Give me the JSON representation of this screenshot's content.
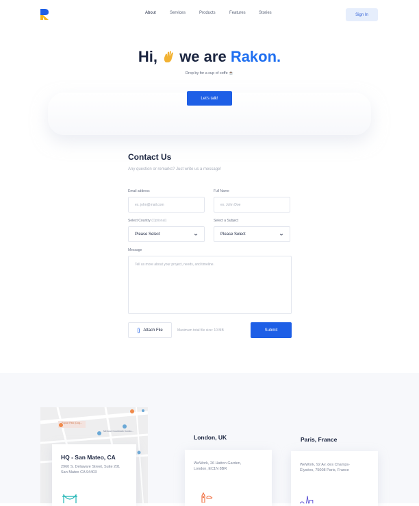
{
  "header": {
    "logo_name": "rakon-logo",
    "nav": [
      {
        "label": "About"
      },
      {
        "label": "Services"
      },
      {
        "label": "Products"
      },
      {
        "label": "Features"
      },
      {
        "label": "Stories"
      }
    ],
    "sign_in": "Sign In"
  },
  "hero": {
    "title_prefix": "Hi,",
    "title_middle": "we are",
    "title_brand": "Rakon.",
    "subtitle": "Drop by for a cup of coffe ☕",
    "cta": "Let's talk!"
  },
  "contact": {
    "title": "Contact Us",
    "subtitle": "Any question or remarks? Just write us a message!",
    "email_label": "Email address",
    "email_placeholder": "ex. john@mail.com",
    "name_label": "Full Name",
    "name_placeholder": "ex. John Doe",
    "country_label": "Select Country",
    "country_optional": "(Optional)",
    "country_value": "Please Select",
    "subject_label": "Select a Subject",
    "subject_value": "Please Select",
    "message_label": "Message",
    "message_placeholder": "Tell us more about your project, needs, and timeline.",
    "attach": "Attach File",
    "max_size": "Maximum total file size: 10 MB",
    "submit": "Submit"
  },
  "offices": {
    "hq": {
      "title": "HQ - San Mateo, CA",
      "address_line1": "2960 S. Delaware Street, Suite 201",
      "address_line2": "San Mateo CA 94403"
    },
    "london": {
      "city": "London, UK",
      "address_line1": "WeWork, 26 Hatton Garden,",
      "address_line2": "London, EC1N 8BR"
    },
    "paris": {
      "city": "Paris, France",
      "address_line1": "WeWork, 92 Av. des Champs-",
      "address_line2": "Élysées, 75008 Paris, France"
    }
  },
  "map_labels": {
    "park": "Poplar Park (Dog...",
    "school": "Melrose Courtmark Condo..."
  },
  "colors": {
    "primary": "#1e5fe6",
    "accent_text": "#1f6ff0",
    "heading": "#1b2540",
    "muted": "#a7adba"
  }
}
